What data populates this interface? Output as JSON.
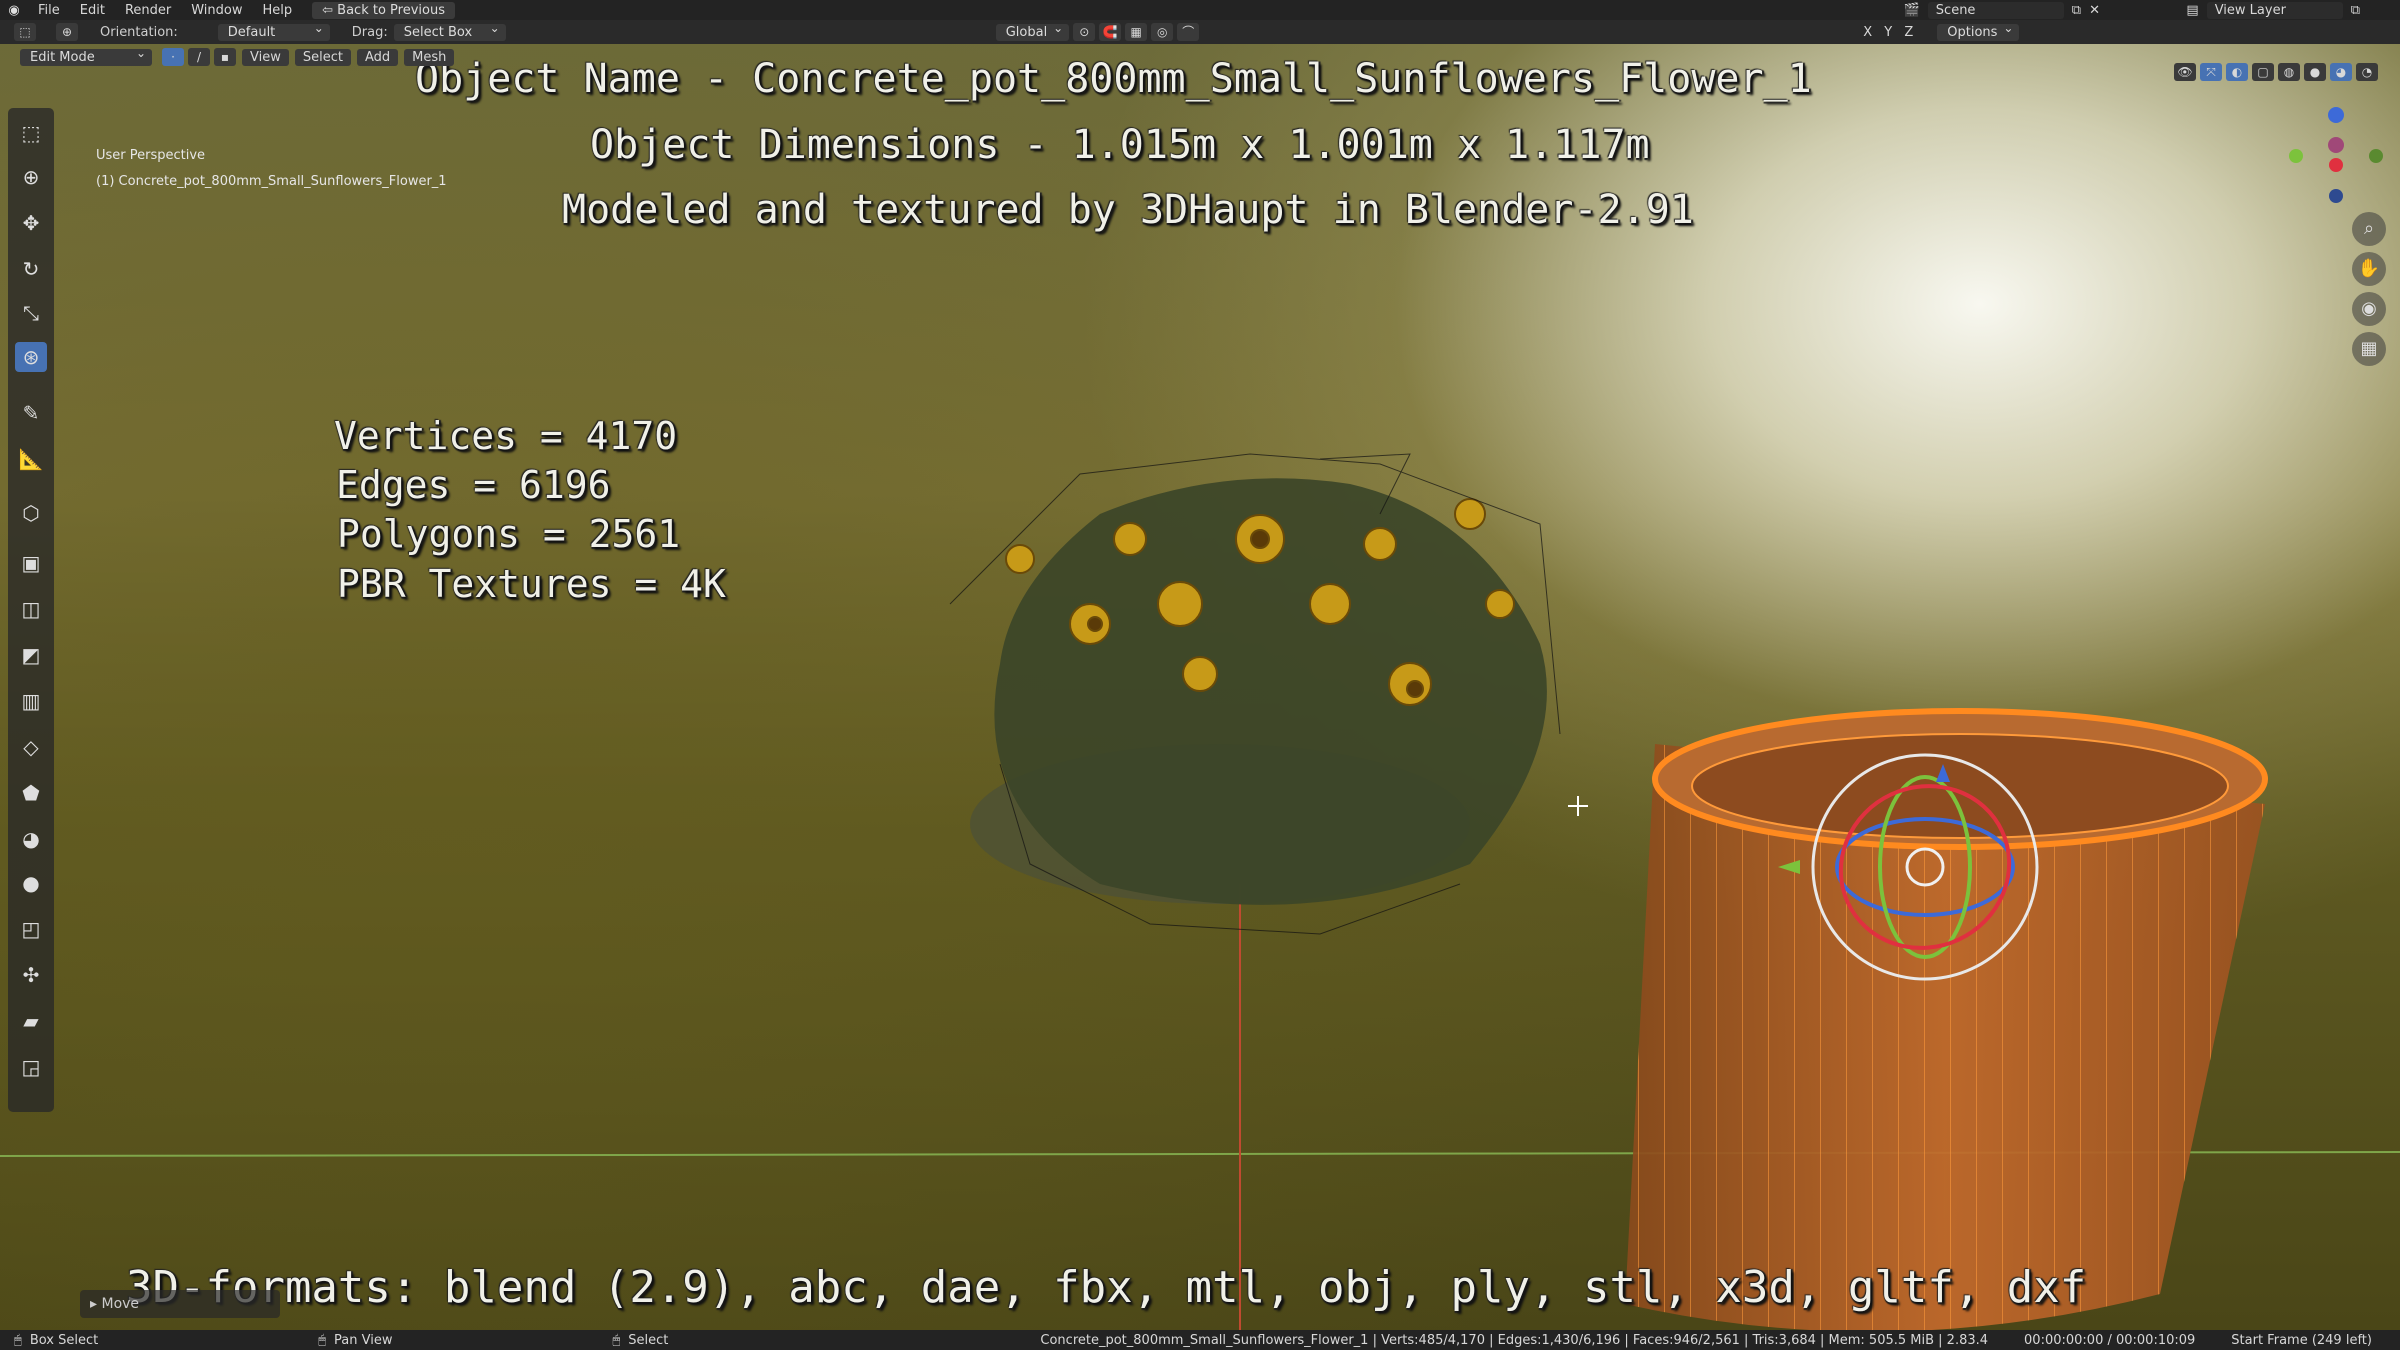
{
  "topbar": {
    "menus": [
      "File",
      "Edit",
      "Render",
      "Window",
      "Help"
    ],
    "back_button": "Back to Previous",
    "scene": "Scene",
    "view_layer": "View Layer"
  },
  "header": {
    "orientation_label": "Orientation:",
    "orientation_value": "Default",
    "drag_label": "Drag:",
    "drag_value": "Select Box",
    "transform_orientation": "Global",
    "axes": [
      "X",
      "Y",
      "Z"
    ],
    "options": "Options"
  },
  "viewport_header": {
    "mode": "Edit Mode",
    "menus": [
      "View",
      "Select",
      "Add",
      "Mesh"
    ]
  },
  "viewport": {
    "perspective": "User Perspective",
    "object_label": "(1) Concrete_pot_800mm_Small_Sunflowers_Flower_1"
  },
  "overlay": {
    "line1": "Object Name - Concrete_pot_800mm_Small_Sunflowers_Flower_1",
    "line2": "Object Dimensions -  1.015m x 1.001m x 1.117m",
    "line3": "Modeled and textured by 3DHaupt in Blender-2.91",
    "stats": [
      "Vertices = 4170",
      "Edges = 6196",
      "Polygons = 2561",
      "PBR Textures = 4K"
    ],
    "formats": "3D-formats: blend (2.9), abc, dae, fbx, mtl, obj, ply, stl, x3d, gltf, dxf"
  },
  "last_operator": "Move",
  "statusbar": {
    "box_select": "Box Select",
    "pan_view": "Pan View",
    "select": "Select",
    "info": "Concrete_pot_800mm_Small_Sunflowers_Flower_1 | Verts:485/4,170 | Edges:1,430/6,196 | Faces:946/2,561 | Tris:3,684 | Mem: 505.5 MiB | 2.83.4",
    "time": "00:00:00:00 / 00:00:10:09",
    "frame": "Start Frame (249 left)"
  },
  "colors": {
    "accent": "#4772b3",
    "wire_orange": "#ff8a1f",
    "pot": "#b8622a"
  }
}
